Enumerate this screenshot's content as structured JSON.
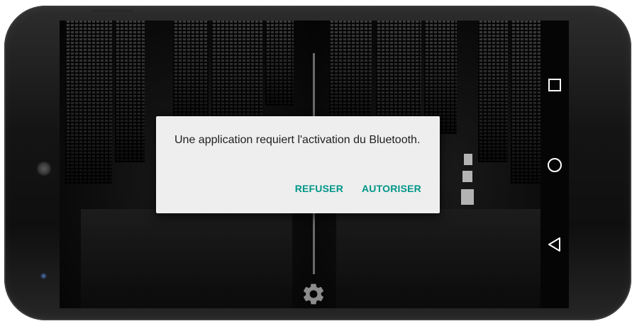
{
  "dialog": {
    "message": "Une application requiert l'activation du Bluetooth.",
    "negative_label": "REFUSER",
    "positive_label": "AUTORISER"
  },
  "icons": {
    "settings": "gear-icon",
    "recents": "square-icon",
    "home": "circle-icon",
    "back": "triangle-back-icon"
  },
  "colors": {
    "accent": "#009688",
    "dialog_bg": "#eeeeee",
    "message_text": "#212121"
  }
}
